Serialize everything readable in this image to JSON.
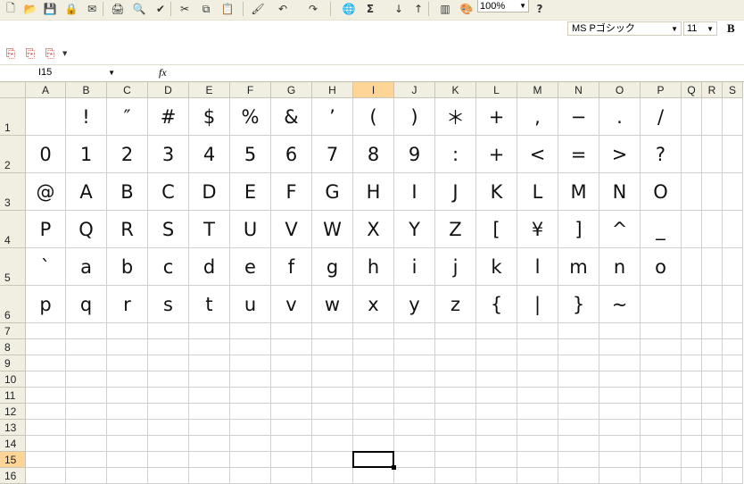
{
  "toolbar": {
    "icons": [
      "new-icon",
      "open-icon",
      "save-icon",
      "permission-icon",
      "email-icon",
      "print-icon",
      "print-preview-icon",
      "spelling-icon",
      "cut-icon",
      "copy-icon",
      "paste-icon",
      "format-painter-icon",
      "undo-icon",
      "redo-icon",
      "hyperlink-icon",
      "autosum-icon",
      "sort-ascending-icon",
      "sort-descending-icon",
      "chart-wizard-icon",
      "drawing-icon",
      "help-icon"
    ],
    "glyphs": [
      "🗋",
      "📂",
      "💾",
      "🖨",
      "🔍",
      "✔",
      "✂",
      "📋",
      "📋",
      "🖌",
      "↶",
      "↷",
      "🌐",
      "Σ",
      "↓",
      "↑",
      "▦",
      "🎨",
      "?"
    ],
    "zoom": "100%",
    "autosum": "Σ",
    "help": "?"
  },
  "format": {
    "font_name": "MS Pゴシック",
    "font_size": "11",
    "bold": "B"
  },
  "pdf_toolbar": {
    "icons": [
      "pdf-create-icon",
      "pdf-email-icon",
      "pdf-review-icon"
    ]
  },
  "formula": {
    "name_box": "I15",
    "fx": "fx",
    "value": ""
  },
  "sheet": {
    "columns": [
      "A",
      "B",
      "C",
      "D",
      "E",
      "F",
      "G",
      "H",
      "I",
      "J",
      "K",
      "L",
      "M",
      "N",
      "O",
      "P",
      "Q",
      "R",
      "S"
    ],
    "rows": [
      "1",
      "2",
      "3",
      "4",
      "5",
      "6",
      "7",
      "8",
      "9",
      "10",
      "11",
      "12",
      "13",
      "14",
      "15",
      "16"
    ],
    "selected_cell": "I15",
    "cells": [
      [
        "",
        "!",
        "″",
        "#",
        "$",
        "%",
        "&",
        "’",
        "(",
        ")",
        "＊",
        "+",
        ",",
        "−",
        ".",
        "/"
      ],
      [
        "0",
        "1",
        "2",
        "3",
        "4",
        "5",
        "6",
        "7",
        "8",
        "9",
        ":",
        "+",
        "<",
        "=",
        ">",
        "?"
      ],
      [
        "@",
        "A",
        "B",
        "C",
        "D",
        "E",
        "F",
        "G",
        "H",
        "I",
        "J",
        "K",
        "L",
        "M",
        "N",
        "O"
      ],
      [
        "P",
        "Q",
        "R",
        "S",
        "T",
        "U",
        "V",
        "W",
        "X",
        "Y",
        "Z",
        "[",
        "¥",
        "]",
        "^",
        "_"
      ],
      [
        "`",
        "a",
        "b",
        "c",
        "d",
        "e",
        "f",
        "g",
        "h",
        "i",
        "j",
        "k",
        "l",
        "m",
        "n",
        "o"
      ],
      [
        "p",
        "q",
        "r",
        "s",
        "t",
        "u",
        "v",
        "w",
        "x",
        "y",
        "z",
        "{",
        "|",
        "}",
        "~",
        ""
      ]
    ]
  }
}
